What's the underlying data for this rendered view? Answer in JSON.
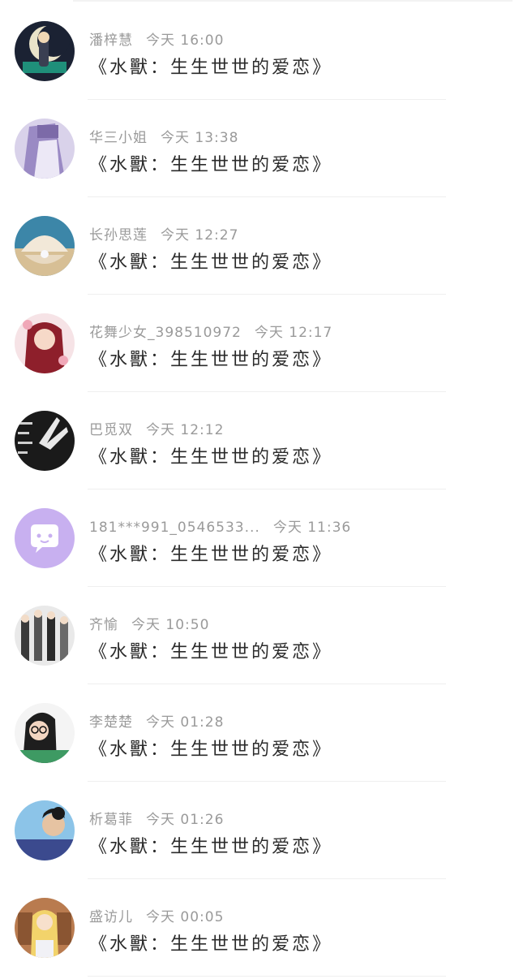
{
  "messages": [
    {
      "name": "潘梓慧",
      "time": "今天 16:00",
      "text": "《水獸：生生世世的爱恋》",
      "avatar": "anime-moon-avatar"
    },
    {
      "name": "华三小姐",
      "time": "今天 13:38",
      "text": "《水獸：生生世世的爱恋》",
      "avatar": "purple-hair-avatar"
    },
    {
      "name": "长孙思莲",
      "time": "今天 12:27",
      "text": "《水獸：生生世世的爱恋》",
      "avatar": "seashell-pearl-avatar"
    },
    {
      "name": "花舞少女_398510972",
      "time": "今天 12:17",
      "text": "《水獸：生生世世的爱恋》",
      "avatar": "anime-girl-red-avatar"
    },
    {
      "name": "巴觅双",
      "time": "今天 12:12",
      "text": "《水獸：生生世世的爱恋》",
      "avatar": "black-white-hands-avatar"
    },
    {
      "name": "181***991_0546533...",
      "time": "今天 11:36",
      "text": "《水獸：生生世世的爱恋》",
      "avatar": "default-chat-bubble-avatar"
    },
    {
      "name": "齐愉",
      "time": "今天 10:50",
      "text": "《水獸：生生世世的爱恋》",
      "avatar": "anime-group-avatar"
    },
    {
      "name": "李楚楚",
      "time": "今天 01:28",
      "text": "《水獸：生生世世的爱恋》",
      "avatar": "girl-glasses-avatar"
    },
    {
      "name": "析葛菲",
      "time": "今天 01:26",
      "text": "《水獸：生生世世的爱恋》",
      "avatar": "boy-blue-sky-avatar"
    },
    {
      "name": "盛访儿",
      "time": "今天 00:05",
      "text": "《水獸：生生世世的爱恋》",
      "avatar": "sailor-moon-avatar"
    }
  ],
  "colors": {
    "name_text": "#9a9a9a",
    "message_text": "#2b2b2b",
    "divider": "#efefef",
    "default_avatar_bg": "#c8b0f0"
  }
}
